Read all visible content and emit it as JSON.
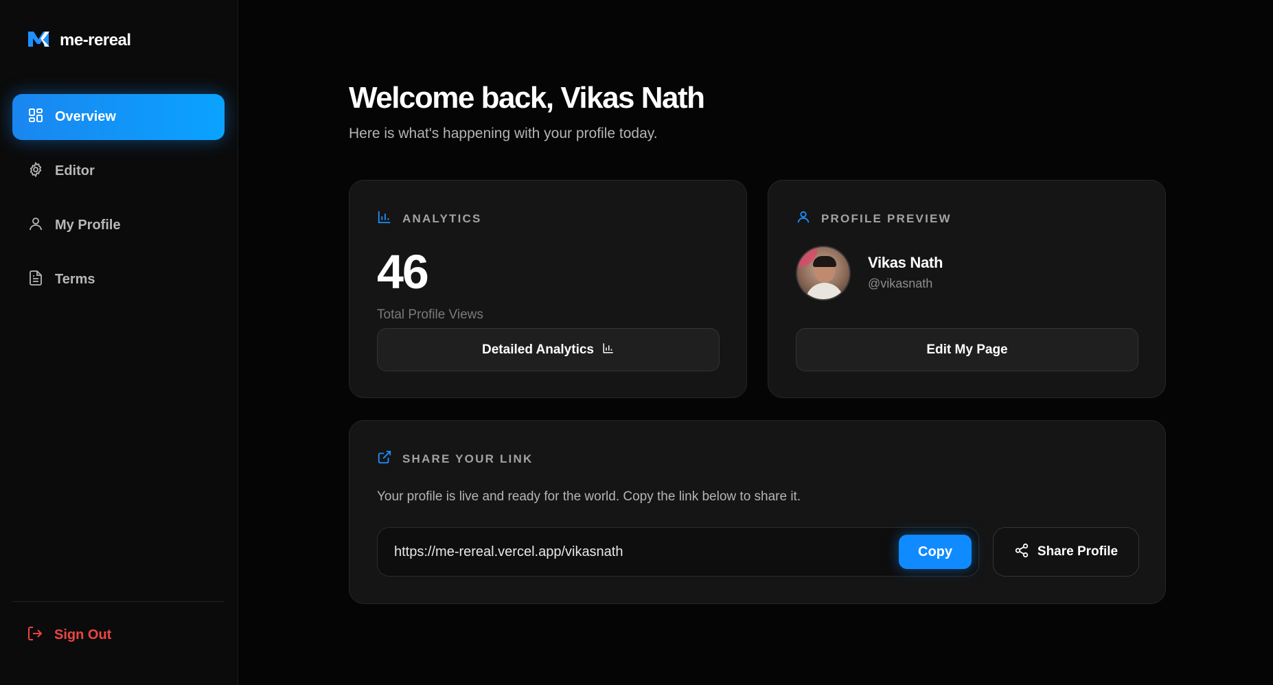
{
  "brand": {
    "name": "me-rereal",
    "logo_icon": "m-logo-icon",
    "accent": "#0f8bff"
  },
  "sidebar": {
    "items": [
      {
        "label": "Overview",
        "icon": "grid-icon",
        "active": true
      },
      {
        "label": "Editor",
        "icon": "gear-icon",
        "active": false
      },
      {
        "label": "My Profile",
        "icon": "user-icon",
        "active": false
      },
      {
        "label": "Terms",
        "icon": "document-icon",
        "active": false
      }
    ],
    "signout": {
      "label": "Sign Out",
      "icon": "logout-icon",
      "color": "#ef4444"
    }
  },
  "header": {
    "welcome": "Welcome back, Vikas Nath",
    "subtitle": "Here is what's happening with your profile today."
  },
  "analytics": {
    "title": "ANALYTICS",
    "icon": "bar-chart-icon",
    "views": "46",
    "views_label": "Total Profile Views",
    "button_label": "Detailed Analytics"
  },
  "profile_preview": {
    "title": "PROFILE PREVIEW",
    "icon": "user-icon",
    "name": "Vikas Nath",
    "handle": "@vikasnath",
    "button_label": "Edit My Page"
  },
  "share": {
    "title": "SHARE YOUR LINK",
    "icon": "external-link-icon",
    "description": "Your profile is live and ready for the world. Copy the link below to share it.",
    "link": "https://me-rereal.vercel.app/vikasnath",
    "copy_label": "Copy",
    "share_label": "Share Profile"
  }
}
